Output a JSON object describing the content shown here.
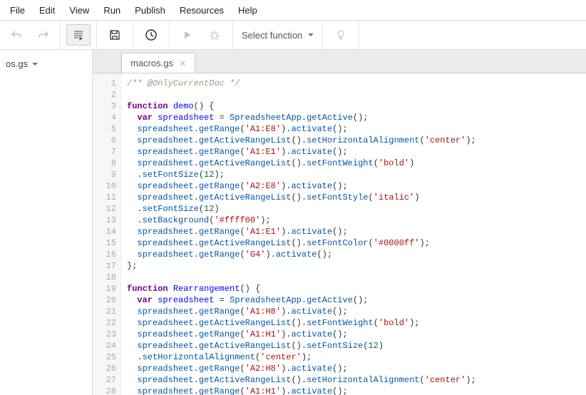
{
  "menubar": [
    "File",
    "Edit",
    "View",
    "Run",
    "Publish",
    "Resources",
    "Help"
  ],
  "toolbar": {
    "selectFnLabel": "Select function"
  },
  "sidebar": {
    "file": "os.gs"
  },
  "tab": {
    "label": "macros.gs"
  },
  "code": {
    "lines": [
      [
        {
          "t": "comment",
          "s": "/** @OnlyCurrentDoc */"
        }
      ],
      [],
      [
        {
          "t": "kw",
          "s": "function"
        },
        {
          "t": "p",
          "s": " "
        },
        {
          "t": "def",
          "s": "demo"
        },
        {
          "t": "p",
          "s": "() {"
        }
      ],
      [
        {
          "t": "p",
          "s": "  "
        },
        {
          "t": "kw",
          "s": "var"
        },
        {
          "t": "p",
          "s": " "
        },
        {
          "t": "def",
          "s": "spreadsheet"
        },
        {
          "t": "p",
          "s": " = "
        },
        {
          "t": "var",
          "s": "SpreadsheetApp"
        },
        {
          "t": "p",
          "s": "."
        },
        {
          "t": "var",
          "s": "getActive"
        },
        {
          "t": "p",
          "s": "();"
        }
      ],
      [
        {
          "t": "p",
          "s": "  "
        },
        {
          "t": "var",
          "s": "spreadsheet"
        },
        {
          "t": "p",
          "s": "."
        },
        {
          "t": "var",
          "s": "getRange"
        },
        {
          "t": "p",
          "s": "("
        },
        {
          "t": "str",
          "s": "'A1:E8'"
        },
        {
          "t": "p",
          "s": ")."
        },
        {
          "t": "var",
          "s": "activate"
        },
        {
          "t": "p",
          "s": "();"
        }
      ],
      [
        {
          "t": "p",
          "s": "  "
        },
        {
          "t": "var",
          "s": "spreadsheet"
        },
        {
          "t": "p",
          "s": "."
        },
        {
          "t": "var",
          "s": "getActiveRangeList"
        },
        {
          "t": "p",
          "s": "()."
        },
        {
          "t": "var",
          "s": "setHorizontalAlignment"
        },
        {
          "t": "p",
          "s": "("
        },
        {
          "t": "str",
          "s": "'center'"
        },
        {
          "t": "p",
          "s": ");"
        }
      ],
      [
        {
          "t": "p",
          "s": "  "
        },
        {
          "t": "var",
          "s": "spreadsheet"
        },
        {
          "t": "p",
          "s": "."
        },
        {
          "t": "var",
          "s": "getRange"
        },
        {
          "t": "p",
          "s": "("
        },
        {
          "t": "str",
          "s": "'A1:E1'"
        },
        {
          "t": "p",
          "s": ")."
        },
        {
          "t": "var",
          "s": "activate"
        },
        {
          "t": "p",
          "s": "();"
        }
      ],
      [
        {
          "t": "p",
          "s": "  "
        },
        {
          "t": "var",
          "s": "spreadsheet"
        },
        {
          "t": "p",
          "s": "."
        },
        {
          "t": "var",
          "s": "getActiveRangeList"
        },
        {
          "t": "p",
          "s": "()."
        },
        {
          "t": "var",
          "s": "setFontWeight"
        },
        {
          "t": "p",
          "s": "("
        },
        {
          "t": "str",
          "s": "'bold'"
        },
        {
          "t": "p",
          "s": ")"
        }
      ],
      [
        {
          "t": "p",
          "s": "  ."
        },
        {
          "t": "var",
          "s": "setFontSize"
        },
        {
          "t": "p",
          "s": "("
        },
        {
          "t": "num",
          "s": "12"
        },
        {
          "t": "p",
          "s": ");"
        }
      ],
      [
        {
          "t": "p",
          "s": "  "
        },
        {
          "t": "var",
          "s": "spreadsheet"
        },
        {
          "t": "p",
          "s": "."
        },
        {
          "t": "var",
          "s": "getRange"
        },
        {
          "t": "p",
          "s": "("
        },
        {
          "t": "str",
          "s": "'A2:E8'"
        },
        {
          "t": "p",
          "s": ")."
        },
        {
          "t": "var",
          "s": "activate"
        },
        {
          "t": "p",
          "s": "();"
        }
      ],
      [
        {
          "t": "p",
          "s": "  "
        },
        {
          "t": "var",
          "s": "spreadsheet"
        },
        {
          "t": "p",
          "s": "."
        },
        {
          "t": "var",
          "s": "getActiveRangeList"
        },
        {
          "t": "p",
          "s": "()."
        },
        {
          "t": "var",
          "s": "setFontStyle"
        },
        {
          "t": "p",
          "s": "("
        },
        {
          "t": "str",
          "s": "'italic'"
        },
        {
          "t": "p",
          "s": ")"
        }
      ],
      [
        {
          "t": "p",
          "s": "  ."
        },
        {
          "t": "var",
          "s": "setFontSize"
        },
        {
          "t": "p",
          "s": "("
        },
        {
          "t": "num",
          "s": "12"
        },
        {
          "t": "p",
          "s": ")"
        }
      ],
      [
        {
          "t": "p",
          "s": "  ."
        },
        {
          "t": "var",
          "s": "setBackground"
        },
        {
          "t": "p",
          "s": "("
        },
        {
          "t": "str",
          "s": "'#ffff00'"
        },
        {
          "t": "p",
          "s": ");"
        }
      ],
      [
        {
          "t": "p",
          "s": "  "
        },
        {
          "t": "var",
          "s": "spreadsheet"
        },
        {
          "t": "p",
          "s": "."
        },
        {
          "t": "var",
          "s": "getRange"
        },
        {
          "t": "p",
          "s": "("
        },
        {
          "t": "str",
          "s": "'A1:E1'"
        },
        {
          "t": "p",
          "s": ")."
        },
        {
          "t": "var",
          "s": "activate"
        },
        {
          "t": "p",
          "s": "();"
        }
      ],
      [
        {
          "t": "p",
          "s": "  "
        },
        {
          "t": "var",
          "s": "spreadsheet"
        },
        {
          "t": "p",
          "s": "."
        },
        {
          "t": "var",
          "s": "getActiveRangeList"
        },
        {
          "t": "p",
          "s": "()."
        },
        {
          "t": "var",
          "s": "setFontColor"
        },
        {
          "t": "p",
          "s": "("
        },
        {
          "t": "str",
          "s": "'#0000ff'"
        },
        {
          "t": "p",
          "s": ");"
        }
      ],
      [
        {
          "t": "p",
          "s": "  "
        },
        {
          "t": "var",
          "s": "spreadsheet"
        },
        {
          "t": "p",
          "s": "."
        },
        {
          "t": "var",
          "s": "getRange"
        },
        {
          "t": "p",
          "s": "("
        },
        {
          "t": "str",
          "s": "'G4'"
        },
        {
          "t": "p",
          "s": ")."
        },
        {
          "t": "var",
          "s": "activate"
        },
        {
          "t": "p",
          "s": "();"
        }
      ],
      [
        {
          "t": "p",
          "s": "};"
        }
      ],
      [],
      [
        {
          "t": "kw",
          "s": "function"
        },
        {
          "t": "p",
          "s": " "
        },
        {
          "t": "def",
          "s": "Rearrangement"
        },
        {
          "t": "p",
          "s": "() {"
        }
      ],
      [
        {
          "t": "p",
          "s": "  "
        },
        {
          "t": "kw",
          "s": "var"
        },
        {
          "t": "p",
          "s": " "
        },
        {
          "t": "def",
          "s": "spreadsheet"
        },
        {
          "t": "p",
          "s": " = "
        },
        {
          "t": "var",
          "s": "SpreadsheetApp"
        },
        {
          "t": "p",
          "s": "."
        },
        {
          "t": "var",
          "s": "getActive"
        },
        {
          "t": "p",
          "s": "();"
        }
      ],
      [
        {
          "t": "p",
          "s": "  "
        },
        {
          "t": "var",
          "s": "spreadsheet"
        },
        {
          "t": "p",
          "s": "."
        },
        {
          "t": "var",
          "s": "getRange"
        },
        {
          "t": "p",
          "s": "("
        },
        {
          "t": "str",
          "s": "'A1:H8'"
        },
        {
          "t": "p",
          "s": ")."
        },
        {
          "t": "var",
          "s": "activate"
        },
        {
          "t": "p",
          "s": "();"
        }
      ],
      [
        {
          "t": "p",
          "s": "  "
        },
        {
          "t": "var",
          "s": "spreadsheet"
        },
        {
          "t": "p",
          "s": "."
        },
        {
          "t": "var",
          "s": "getActiveRangeList"
        },
        {
          "t": "p",
          "s": "()."
        },
        {
          "t": "var",
          "s": "setFontWeight"
        },
        {
          "t": "p",
          "s": "("
        },
        {
          "t": "str",
          "s": "'bold'"
        },
        {
          "t": "p",
          "s": ");"
        }
      ],
      [
        {
          "t": "p",
          "s": "  "
        },
        {
          "t": "var",
          "s": "spreadsheet"
        },
        {
          "t": "p",
          "s": "."
        },
        {
          "t": "var",
          "s": "getRange"
        },
        {
          "t": "p",
          "s": "("
        },
        {
          "t": "str",
          "s": "'A1:H1'"
        },
        {
          "t": "p",
          "s": ")."
        },
        {
          "t": "var",
          "s": "activate"
        },
        {
          "t": "p",
          "s": "();"
        }
      ],
      [
        {
          "t": "p",
          "s": "  "
        },
        {
          "t": "var",
          "s": "spreadsheet"
        },
        {
          "t": "p",
          "s": "."
        },
        {
          "t": "var",
          "s": "getActiveRangeList"
        },
        {
          "t": "p",
          "s": "()."
        },
        {
          "t": "var",
          "s": "setFontSize"
        },
        {
          "t": "p",
          "s": "("
        },
        {
          "t": "num",
          "s": "12"
        },
        {
          "t": "p",
          "s": ")"
        }
      ],
      [
        {
          "t": "p",
          "s": "  ."
        },
        {
          "t": "var",
          "s": "setHorizontalAlignment"
        },
        {
          "t": "p",
          "s": "("
        },
        {
          "t": "str",
          "s": "'center'"
        },
        {
          "t": "p",
          "s": ");"
        }
      ],
      [
        {
          "t": "p",
          "s": "  "
        },
        {
          "t": "var",
          "s": "spreadsheet"
        },
        {
          "t": "p",
          "s": "."
        },
        {
          "t": "var",
          "s": "getRange"
        },
        {
          "t": "p",
          "s": "("
        },
        {
          "t": "str",
          "s": "'A2:H8'"
        },
        {
          "t": "p",
          "s": ")."
        },
        {
          "t": "var",
          "s": "activate"
        },
        {
          "t": "p",
          "s": "();"
        }
      ],
      [
        {
          "t": "p",
          "s": "  "
        },
        {
          "t": "var",
          "s": "spreadsheet"
        },
        {
          "t": "p",
          "s": "."
        },
        {
          "t": "var",
          "s": "getActiveRangeList"
        },
        {
          "t": "p",
          "s": "()."
        },
        {
          "t": "var",
          "s": "setHorizontalAlignment"
        },
        {
          "t": "p",
          "s": "("
        },
        {
          "t": "str",
          "s": "'center'"
        },
        {
          "t": "p",
          "s": ");"
        }
      ],
      [
        {
          "t": "p",
          "s": "  "
        },
        {
          "t": "var",
          "s": "spreadsheet"
        },
        {
          "t": "p",
          "s": "."
        },
        {
          "t": "var",
          "s": "getRange"
        },
        {
          "t": "p",
          "s": "("
        },
        {
          "t": "str",
          "s": "'A1:H1'"
        },
        {
          "t": "p",
          "s": ")."
        },
        {
          "t": "var",
          "s": "activate"
        },
        {
          "t": "p",
          "s": "();"
        }
      ]
    ]
  }
}
